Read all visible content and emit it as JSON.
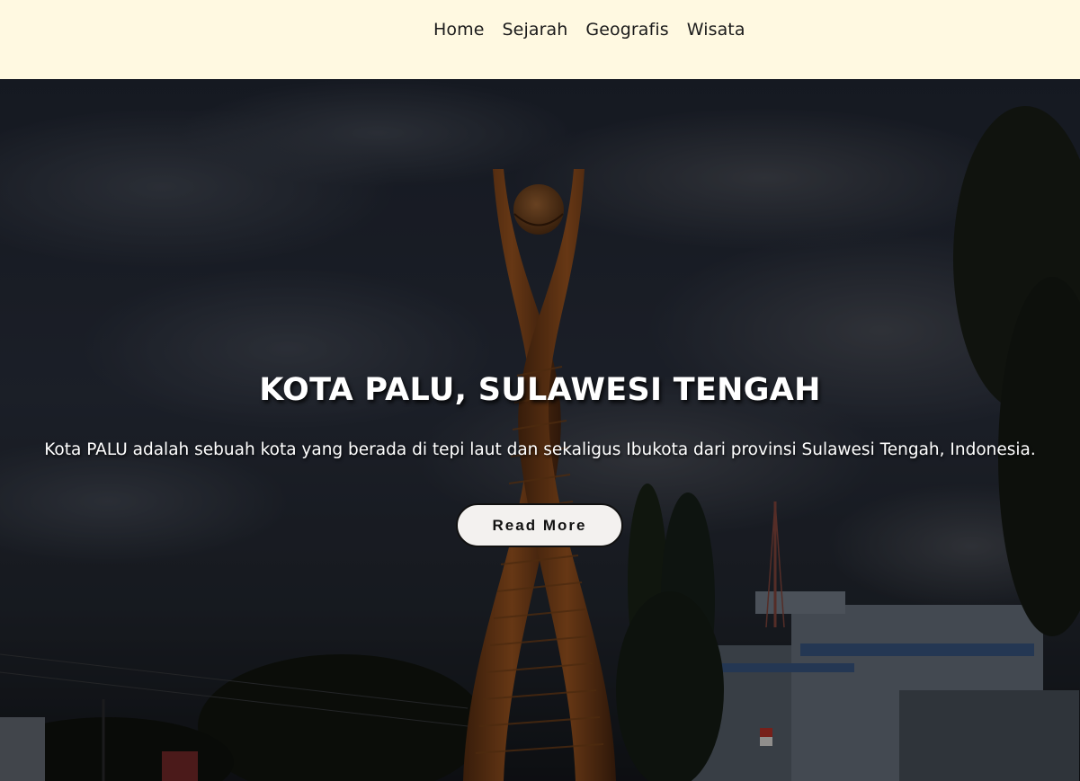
{
  "nav": {
    "items": [
      {
        "label": "Home"
      },
      {
        "label": "Sejarah"
      },
      {
        "label": "Geografis"
      },
      {
        "label": "Wisata"
      }
    ]
  },
  "hero": {
    "title": "KOTA PALU, SULAWESI TENGAH",
    "description": "Kota PALU adalah sebuah kota yang berada di tepi laut dan sekaligus Ibukota dari provinsi Sulawesi Tengah, Indonesia.",
    "button_label": "Read More",
    "background_image": "palu-monument-photo"
  },
  "colors": {
    "navbar_bg": "#fff9e1",
    "nav_text": "#1b1b1b",
    "hero_text": "#ffffff",
    "button_bg": "#f3f1ef",
    "button_border": "#111111"
  }
}
